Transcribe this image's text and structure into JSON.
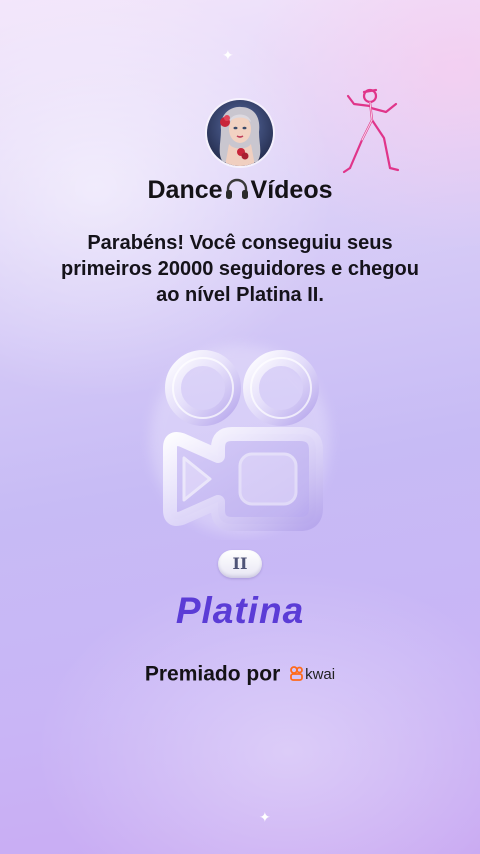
{
  "profile": {
    "username_part1": "Dance",
    "username_part2": "Vídeos",
    "username_icon": "headphones-icon",
    "avatar": "profile-avatar-illustration",
    "sticker": "dancer-sticker"
  },
  "message": {
    "text": "Parabéns! Você conseguiu seus primeiros 20000 seguidores e chegou ao nível Platina II."
  },
  "badge": {
    "icon": "kwai-camera-badge-icon",
    "level": "II",
    "tier": "Platina"
  },
  "footer": {
    "awarded_by": "Premiado por",
    "brand": "kwai"
  },
  "colors": {
    "tier_text": "#5b3cd6",
    "brand_orange": "#ff6a1a",
    "sticker_pink": "#e0358a"
  }
}
